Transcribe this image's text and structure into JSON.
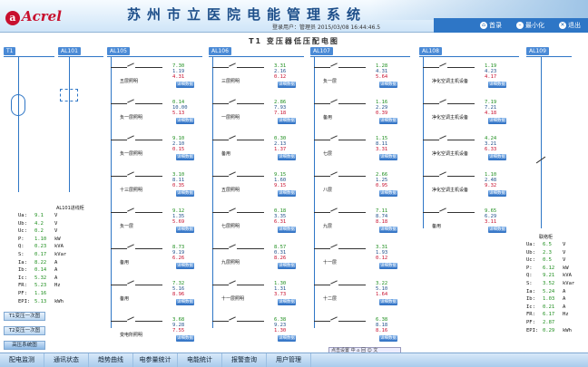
{
  "header": {
    "logo": "Acrel",
    "logo_mark": "a",
    "title": "苏州市立医院电能管理系统",
    "user_label": "登录用户：",
    "user": "管理员",
    "datetime": "2015/03/08 16:44:46.5",
    "buttons": [
      {
        "label": "首录",
        "icon": "home-icon"
      },
      {
        "label": "最小化",
        "icon": "minimize-icon"
      },
      {
        "label": "退出",
        "icon": "exit-icon"
      }
    ]
  },
  "diagram_title": "T1 变压器低压配电图",
  "tags": [
    "T1",
    "AL101",
    "AL105",
    "AL106",
    "AL107",
    "AL108",
    "AL109"
  ],
  "feeder_label": "AL101进线柜",
  "tie_label": "联络柜",
  "detail_label": "详细数据",
  "columns": [
    [
      {
        "name": "五层照明",
        "v": [
          "7.30",
          "1.19",
          "4.31"
        ]
      },
      {
        "name": "负一层照明",
        "v": [
          "0.14",
          "10.00",
          "5.13"
        ]
      },
      {
        "name": "负一层照明",
        "v": [
          "9.10",
          "2.10",
          "0.15"
        ]
      },
      {
        "name": "十三层照明",
        "v": [
          "3.10",
          "8.11",
          "0.35"
        ]
      },
      {
        "name": "负一层",
        "v": [
          "9.12",
          "1.35",
          "5.69"
        ]
      },
      {
        "name": "备用",
        "v": [
          "8.73",
          "9.19",
          "6.26"
        ]
      },
      {
        "name": "备用",
        "v": [
          "7.32",
          "5.16",
          "8.96"
        ]
      },
      {
        "name": "变电所照明",
        "v": [
          "3.68",
          "9.28",
          "7.55"
        ]
      }
    ],
    [
      {
        "name": "三层照明",
        "v": [
          "3.31",
          "2.16",
          "0.12"
        ]
      },
      {
        "name": "一层照明",
        "v": [
          "2.86",
          "7.93",
          "7.18"
        ]
      },
      {
        "name": "备用",
        "v": [
          "0.30",
          "2.13",
          "1.37"
        ]
      },
      {
        "name": "五层照明",
        "v": [
          "9.15",
          "1.60",
          "9.15"
        ]
      },
      {
        "name": "七层照明",
        "v": [
          "0.18",
          "3.35",
          "6.31"
        ]
      },
      {
        "name": "九层照明",
        "v": [
          "8.57",
          "0.31",
          "8.26"
        ]
      },
      {
        "name": "十一层照明",
        "v": [
          "1.30",
          "1.31",
          "3.73"
        ]
      },
      {
        "name": "",
        "v": [
          "6.38",
          "9.23",
          "1.30"
        ]
      }
    ],
    [
      {
        "name": "负一层",
        "v": [
          "1.28",
          "4.31",
          "5.64"
        ]
      },
      {
        "name": "备用",
        "v": [
          "1.16",
          "2.29",
          "0.39"
        ]
      },
      {
        "name": "七层",
        "v": [
          "1.15",
          "8.11",
          "3.31"
        ]
      },
      {
        "name": "八层",
        "v": [
          "2.66",
          "1.25",
          "0.95"
        ]
      },
      {
        "name": "九层",
        "v": [
          "7.11",
          "8.74",
          "8.18"
        ]
      },
      {
        "name": "十一层",
        "v": [
          "3.31",
          "1.93",
          "0.12"
        ]
      },
      {
        "name": "十二层",
        "v": [
          "3.22",
          "5.10",
          "1.64"
        ]
      },
      {
        "name": "",
        "v": [
          "6.38",
          "8.18",
          "8.16"
        ]
      }
    ],
    [
      {
        "name": "净化空调主机设备",
        "v": [
          "1.19",
          "4.23",
          "4.17"
        ]
      },
      {
        "name": "净化空调主机设备",
        "v": [
          "7.19",
          "7.21",
          "4.18"
        ]
      },
      {
        "name": "净化空调主机设备",
        "v": [
          "4.24",
          "3.21",
          "6.33"
        ]
      },
      {
        "name": "净化空调主机设备",
        "v": [
          "1.10",
          "2.48",
          "9.32"
        ]
      },
      {
        "name": "备用",
        "v": [
          "9.65",
          "6.29",
          "3.11"
        ]
      }
    ]
  ],
  "feeder_params": [
    [
      "Ua:",
      "9.1",
      "V"
    ],
    [
      "Ub:",
      "4.2",
      "V"
    ],
    [
      "Uc:",
      "0.2",
      "V"
    ],
    [
      "P:",
      "1.10",
      "kW"
    ],
    [
      "Q:",
      "0.23",
      "kVA"
    ],
    [
      "S:",
      "0.17",
      "kVar"
    ],
    [
      "Ia:",
      "8.22",
      "A"
    ],
    [
      "Ib:",
      "0.14",
      "A"
    ],
    [
      "Ic:",
      "5.32",
      "A"
    ],
    [
      "FR:",
      "5.23",
      "Hz"
    ],
    [
      "PF:",
      "1.16",
      ""
    ],
    [
      "EPI:",
      "5.13",
      "kWh"
    ]
  ],
  "tie_params": [
    [
      "Ua:",
      "6.5",
      "V"
    ],
    [
      "Ub:",
      "2.3",
      "V"
    ],
    [
      "Uc:",
      "0.5",
      "V"
    ],
    [
      "P:",
      "6.12",
      "kW"
    ],
    [
      "Q:",
      "9.21",
      "kVA"
    ],
    [
      "S:",
      "3.52",
      "kVar"
    ],
    [
      "Ia:",
      "5.24",
      "A"
    ],
    [
      "Ib:",
      "1.03",
      "A"
    ],
    [
      "Ic:",
      "0.21",
      "A"
    ],
    [
      "FR:",
      "6.17",
      "Hz"
    ],
    [
      "PF:",
      "2.87",
      ""
    ],
    [
      "EPI:",
      "0.29",
      "kWh"
    ]
  ],
  "nav_buttons": [
    "T1变压一次图",
    "T2变压一次图",
    "高压系统图"
  ],
  "ime_text": "点击设置 中 ⌂ 回 ☺ 文",
  "menu": [
    "配电监测",
    "通讯状态",
    "趋势曲线",
    "电参量统计",
    "电能统计",
    "报警查询",
    "用户管理"
  ]
}
